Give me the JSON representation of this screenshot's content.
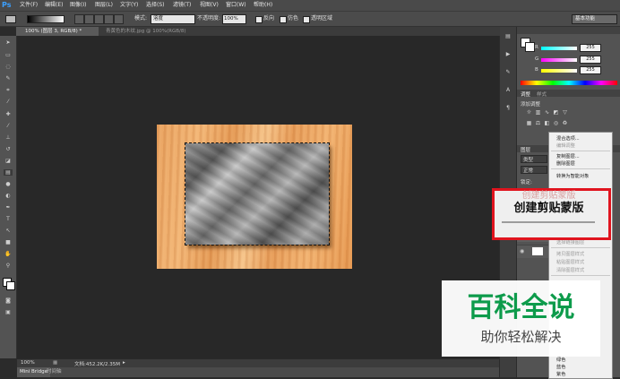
{
  "app": {
    "logo": "Ps"
  },
  "menubar": {
    "items": [
      "文件(F)",
      "编辑(E)",
      "图像(I)",
      "图层(L)",
      "文字(Y)",
      "选择(S)",
      "滤镜(T)",
      "视图(V)",
      "窗口(W)",
      "帮助(H)"
    ]
  },
  "options": {
    "mode_label": "模式:",
    "mode_value": "溶度",
    "opacity_label": "不透明度:",
    "opacity_value": "100%",
    "reverse_label": "反向",
    "dither_label": "仿色",
    "transparency_label": "透明区域",
    "workspace": "基本功能"
  },
  "tabs": [
    {
      "label": "100% (图层 3, RGB/8) *",
      "active": true
    },
    {
      "label": "青黄色的木纹.jpg @ 100%(RGB/8)",
      "active": false
    }
  ],
  "status": {
    "zoom": "100%",
    "doc_info": "文档:452.2K/2.35M",
    "arrow": "▸"
  },
  "bottom_tabs": [
    "Mini Bridge",
    "时间轴"
  ],
  "color_panel": {
    "r_label": "R",
    "g_label": "G",
    "b_label": "B",
    "r_value": "255",
    "g_value": "255",
    "b_value": "255"
  },
  "adjust_panel": {
    "tab1": "调整",
    "tab2": "样式",
    "title": "添加调整"
  },
  "layers_panel": {
    "tab_layers": "图层",
    "kind_label": "类型",
    "blend_label": "正常",
    "lock_label": "锁定:"
  },
  "context_menu": {
    "items": [
      {
        "label": "混合选项...",
        "disabled": false
      },
      {
        "label": "编辑调整",
        "disabled": true
      },
      {
        "sep": true
      },
      {
        "label": "复制图层...",
        "disabled": false
      },
      {
        "label": "删除图层",
        "disabled": false
      },
      {
        "sep": true
      },
      {
        "label": "转换为智能对象",
        "disabled": false
      },
      {
        "sep": true
      },
      {
        "label": "选择链接图层",
        "disabled": true
      },
      {
        "sep": true
      },
      {
        "label": "拷贝图层样式",
        "disabled": true
      },
      {
        "label": "粘贴图层样式",
        "disabled": true
      },
      {
        "label": "清除图层样式",
        "disabled": true
      },
      {
        "sep": true
      },
      {
        "label": "绿色",
        "disabled": false
      },
      {
        "label": "蓝色",
        "disabled": false
      },
      {
        "label": "紫色",
        "disabled": false
      }
    ]
  },
  "callout": {
    "faded_text": "创建剪贴蒙版",
    "text": "创建剪贴蒙版"
  },
  "watermark": {
    "title": "百科全说",
    "subtitle": "助你轻松解决"
  },
  "colors": {
    "highlight_red": "#e0141e",
    "watermark_green": "#0d9b4b",
    "wood": "#f0ae6b"
  },
  "icons": {
    "tools": [
      "move-icon",
      "marquee-icon",
      "lasso-icon",
      "quick-select-icon",
      "crop-icon",
      "eyedropper-icon",
      "healing-icon",
      "brush-icon",
      "clone-stamp-icon",
      "history-brush-icon",
      "eraser-icon",
      "gradient-icon",
      "blur-icon",
      "dodge-icon",
      "pen-icon",
      "type-icon",
      "path-select-icon",
      "shape-icon",
      "hand-icon",
      "zoom-icon",
      "color-swatch-icon",
      "quickmask-icon",
      "screen-mode-icon"
    ]
  }
}
